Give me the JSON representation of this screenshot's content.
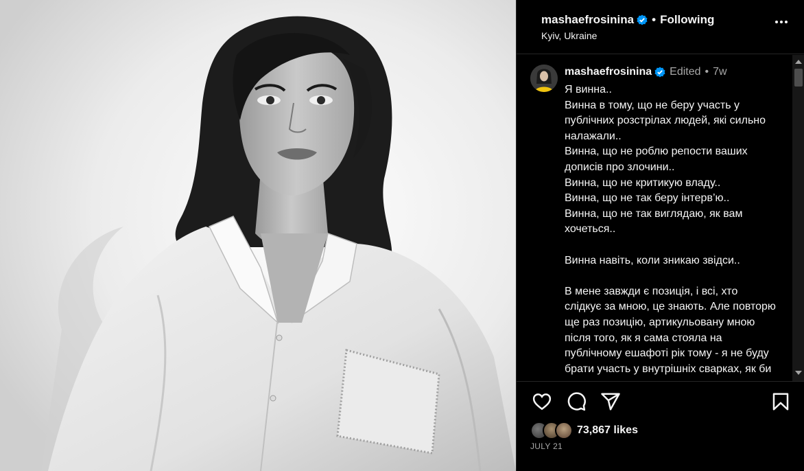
{
  "header": {
    "username": "mashaefrosinina",
    "separator": "•",
    "follow_status": "Following",
    "location": "Kyiv, Ukraine"
  },
  "caption": {
    "username": "mashaefrosinina",
    "edited": "Edited",
    "separator": "•",
    "time_ago": "7w",
    "text": "Я винна..\nВинна в тому, що не беру участь у публічних розстрілах людей, які сильно налажали..\nВинна, що не роблю репости ваших дописів про злочини..\nВинна, що не критикую владу..\nВинна, що не так беру інтерв’ю..\nВинна, що не так виглядаю, як вам хочеться..\n\nВинна навіть, коли зникаю звідси..\n\nВ мене завжди є позиція, і всі, хто слідкує за мною, це знають. Але повторю ще раз позицію, артикульовану мною після того, як я сама стояла на публічному ешафоті рік тому - я не буду брати участь у внутрішніх сварках, як би сильно мене"
  },
  "actions": {
    "like_icon": "heart-icon",
    "comment_icon": "comment-icon",
    "share_icon": "paper-plane-icon",
    "save_icon": "bookmark-icon"
  },
  "likes": {
    "count_text": "73,867 likes"
  },
  "post_date": "JULY 21",
  "colors": {
    "background": "#000000",
    "verified_badge": "#0095f6",
    "secondary_text": "#a8a8a8"
  }
}
